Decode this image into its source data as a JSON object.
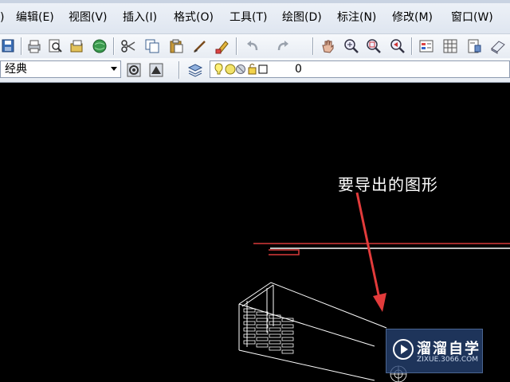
{
  "menu": {
    "items": [
      {
        "label": ")"
      },
      {
        "label": "编辑(E)"
      },
      {
        "label": "视图(V)"
      },
      {
        "label": "插入(I)"
      },
      {
        "label": "格式(O)"
      },
      {
        "label": "工具(T)"
      },
      {
        "label": "绘图(D)"
      },
      {
        "label": "标注(N)"
      },
      {
        "label": "修改(M)"
      },
      {
        "label": "窗口(W)"
      }
    ]
  },
  "toolbar": {
    "icons": [
      "save-icon",
      "print-icon",
      "print-preview-icon",
      "publish-icon",
      "globe-icon",
      "cut-icon",
      "copy-icon",
      "paste-icon",
      "brush-icon",
      "match-properties-icon",
      "undo-icon",
      "redo-icon",
      "pan-icon",
      "zoom-realtime-icon",
      "zoom-window-icon",
      "zoom-previous-icon",
      "properties-icon",
      "design-center-icon",
      "tool-palette-icon",
      "sheet-set-icon"
    ]
  },
  "workspace": {
    "selected": "经典"
  },
  "layer": {
    "current": "0"
  },
  "canvas": {
    "annotation": "要导出的图形",
    "background": "#000000",
    "arrow_color": "#e23b3b",
    "line_color": "#ffffff"
  },
  "watermark": {
    "title": "溜溜自学",
    "subtitle": "ZIXUE.3066.COM"
  }
}
